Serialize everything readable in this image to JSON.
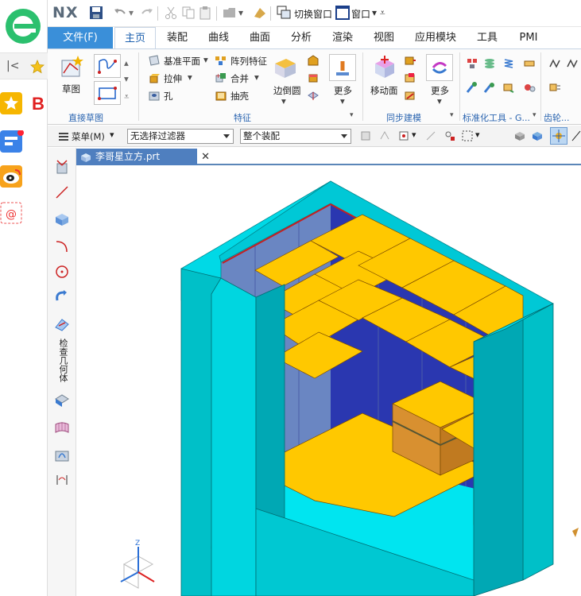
{
  "qat": {
    "logo": "NX",
    "switch_window": "切换窗口",
    "window": "窗口"
  },
  "tabs": [
    "文件(F)",
    "主页",
    "装配",
    "曲线",
    "曲面",
    "分析",
    "渲染",
    "视图",
    "应用模块",
    "工具",
    "PMI"
  ],
  "ribbon": {
    "sketch": "草图",
    "direct_sketch": "直接草图",
    "datum_plane": "基准平面",
    "extrude": "拉伸",
    "hole": "孔",
    "pattern_feature": "阵列特征",
    "unite": "合并",
    "shell": "抽壳",
    "edge_blend": "边倒圆",
    "more1": "更多",
    "feature": "特征",
    "move_face": "移动面",
    "more2": "更多",
    "sync_modeling": "同步建模",
    "std_tools": "标准化工具 - G...",
    "gear": "齿轮..."
  },
  "cmdbar": {
    "menu": "菜单(M)",
    "filter": "无选择过滤器",
    "scope": "整个装配"
  },
  "doc_tab": {
    "label": "李哥星立方.prt"
  },
  "left_toolbar": {
    "check_geometry": "检查几何体"
  },
  "browser": {
    "partial_letter": "B"
  },
  "colors": {
    "cyan": "#00c8d2",
    "yellow": "#ffc800",
    "blue": "#2e3ab5",
    "file_tab": "#3a8fd9"
  }
}
